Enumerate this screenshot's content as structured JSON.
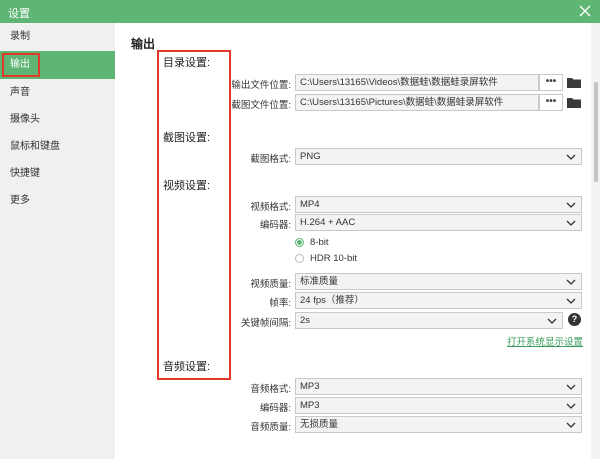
{
  "window": {
    "title": "设置",
    "close_icon": "close-icon"
  },
  "sidebar": {
    "items": [
      {
        "label": "录制"
      },
      {
        "label": "输出"
      },
      {
        "label": "声音"
      },
      {
        "label": "摄像头"
      },
      {
        "label": "鼠标和键盘"
      },
      {
        "label": "快捷键"
      },
      {
        "label": "更多"
      }
    ],
    "active_index": 1
  },
  "main": {
    "section_title": "输出",
    "groups": {
      "directory": "目录设置:",
      "screenshot": "截图设置:",
      "video": "视频设置:",
      "audio": "音频设置:"
    },
    "directory": {
      "output_label": "输出文件位置:",
      "output_path": "C:\\Users\\13165\\Videos\\数据蛙\\数据蛙录屏软件",
      "screenshot_label": "截图文件位置:",
      "screenshot_path": "C:\\Users\\13165\\Pictures\\数据蛙\\数据蛙录屏软件",
      "browse_label": "•••"
    },
    "screenshot": {
      "format_label": "截图格式:",
      "format_value": "PNG"
    },
    "video": {
      "format_label": "视频格式:",
      "format_value": "MP4",
      "encoder_label": "编码器:",
      "encoder_value": "H.264 + AAC",
      "bit_8": "8-bit",
      "bit_hdr": "HDR 10-bit",
      "quality_label": "视频质量:",
      "quality_value": "标准质量",
      "fps_label": "帧率:",
      "fps_value": "24 fps（推荐）",
      "keyframe_label": "关键帧间隔:",
      "keyframe_value": "2s",
      "help_glyph": "?",
      "system_link": "打开系统显示设置"
    },
    "audio": {
      "format_label": "音频格式:",
      "format_value": "MP3",
      "encoder_label": "编码器:",
      "encoder_value": "MP3",
      "quality_label": "音频质量:",
      "quality_value": "无损质量"
    }
  },
  "colors": {
    "accent": "#5fb574",
    "highlight": "#e03a2a",
    "link": "#3a9c5a"
  }
}
